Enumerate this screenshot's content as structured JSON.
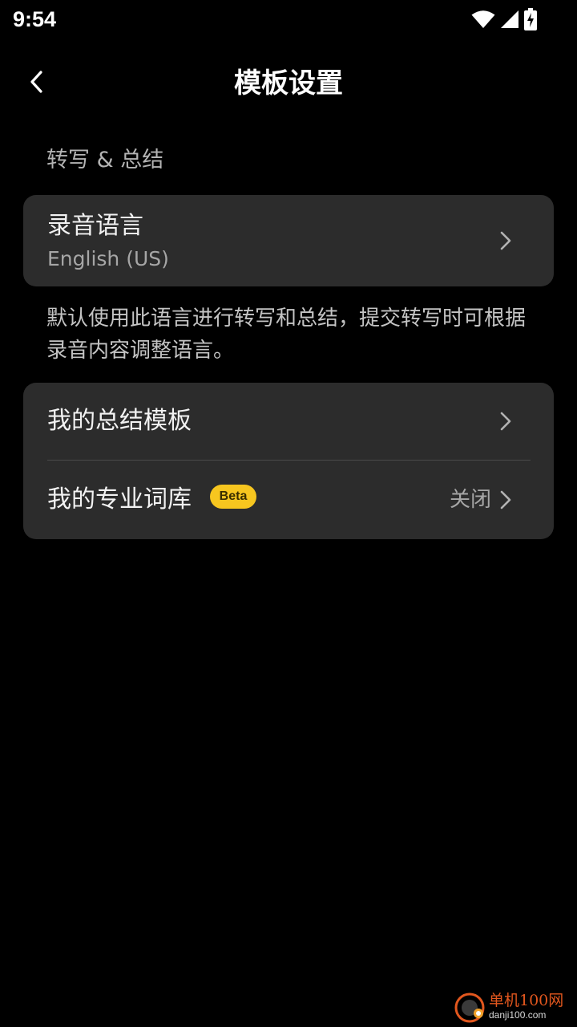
{
  "status_bar": {
    "time": "9:54",
    "icons": [
      "wifi-icon",
      "signal-icon",
      "battery-charging-icon"
    ]
  },
  "header": {
    "back_icon": "chevron-left-icon",
    "title": "模板设置"
  },
  "section": {
    "label": "转写 & 总结"
  },
  "language_card": {
    "title": "录音语言",
    "value": "English (US)"
  },
  "description": "默认使用此语言进行转写和总结，提交转写时可根据录音内容调整语言。",
  "settings_card": {
    "templates": {
      "label": "我的总结模板"
    },
    "glossary": {
      "label": "我的专业词库",
      "badge": "Beta",
      "value": "关闭"
    }
  },
  "watermark": {
    "title": "单机100网",
    "subtitle": "danji100.com"
  },
  "colors": {
    "background": "#000000",
    "card": "#2c2c2c",
    "badge": "#f7c61f",
    "watermark_accent": "#e2571e"
  }
}
